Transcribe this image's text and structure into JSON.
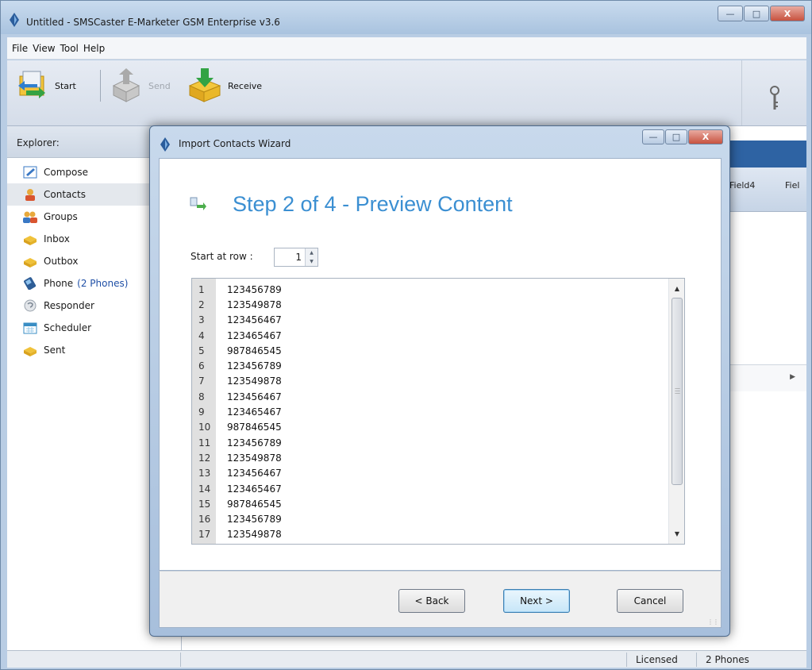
{
  "app": {
    "title": "Untitled - SMSCaster E-Marketer GSM Enterprise v3.6"
  },
  "menu": [
    "File",
    "View",
    "Tool",
    "Help"
  ],
  "toolbar": {
    "start_label": "Start",
    "send_label": "Send",
    "receive_label": "Receive"
  },
  "explorer": {
    "header": "Explorer:",
    "items": [
      {
        "label": "Compose",
        "icon": "compose-icon"
      },
      {
        "label": "Contacts",
        "icon": "contacts-icon"
      },
      {
        "label": "Groups",
        "icon": "groups-icon"
      },
      {
        "label": "Inbox",
        "icon": "inbox-icon"
      },
      {
        "label": "Outbox",
        "icon": "outbox-icon"
      },
      {
        "label": "Phone",
        "extra": "(2 Phones)",
        "icon": "phone-icon"
      },
      {
        "label": "Responder",
        "icon": "responder-icon"
      },
      {
        "label": "Scheduler",
        "icon": "scheduler-icon"
      },
      {
        "label": "Sent",
        "icon": "sent-icon"
      }
    ]
  },
  "grid": {
    "columns": [
      "Field4",
      "Fiel"
    ]
  },
  "status": {
    "license": "Licensed",
    "phones": "2 Phones"
  },
  "wizard": {
    "title": "Import Contacts Wizard",
    "step_title": "Step 2 of 4 - Preview Content",
    "start_row_label": "Start at row :",
    "start_row_value": "1",
    "rows": [
      {
        "n": "1",
        "v": "123456789"
      },
      {
        "n": "2",
        "v": "123549878"
      },
      {
        "n": "3",
        "v": "123456467"
      },
      {
        "n": "4",
        "v": "123465467"
      },
      {
        "n": "5",
        "v": "987846545"
      },
      {
        "n": "6",
        "v": "123456789"
      },
      {
        "n": "7",
        "v": "123549878"
      },
      {
        "n": "8",
        "v": "123456467"
      },
      {
        "n": "9",
        "v": "123465467"
      },
      {
        "n": "10",
        "v": "987846545"
      },
      {
        "n": "11",
        "v": "123456789"
      },
      {
        "n": "12",
        "v": "123549878"
      },
      {
        "n": "13",
        "v": "123456467"
      },
      {
        "n": "14",
        "v": "123465467"
      },
      {
        "n": "15",
        "v": "987846545"
      },
      {
        "n": "16",
        "v": "123456789"
      },
      {
        "n": "17",
        "v": "123549878"
      }
    ],
    "back_label": "< Back",
    "next_label": "Next >",
    "cancel_label": "Cancel"
  },
  "colors": {
    "step_title": "#3b8fd2",
    "content_header_blue": "#2e63a3",
    "phone_count": "#1f4fa6"
  }
}
